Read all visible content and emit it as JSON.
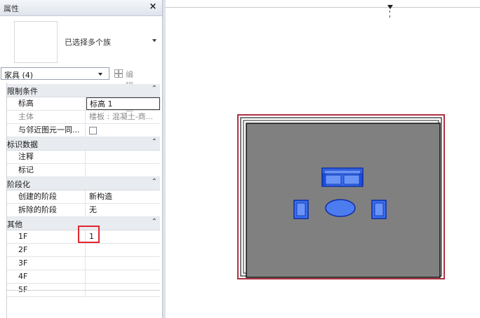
{
  "palette": {
    "title": "属性",
    "close_glyph": "×",
    "type_selector": {
      "label": "已选择多个族",
      "dropdown_icon": "chevron-down-icon"
    },
    "filter": {
      "label": "家具 (4)",
      "edit_type_label": "编辑类型"
    },
    "groups": [
      {
        "label": "限制条件",
        "collapse_glyph": "⌃",
        "rows": [
          {
            "name": "标高",
            "value": "标高 1",
            "editing": true,
            "dim": false
          },
          {
            "name": "主体",
            "value": "楼板 : 混凝土-商...",
            "editing": false,
            "dim": true
          },
          {
            "name": "与邻近图元一同...",
            "value": "",
            "checkbox": true
          }
        ]
      },
      {
        "label": "标识数据",
        "collapse_glyph": "⌃",
        "rows": [
          {
            "name": "注释",
            "value": ""
          },
          {
            "name": "标记",
            "value": ""
          }
        ]
      },
      {
        "label": "阶段化",
        "collapse_glyph": "⌃",
        "rows": [
          {
            "name": "创建的阶段",
            "value": "新构造"
          },
          {
            "name": "拆除的阶段",
            "value": "无"
          }
        ]
      },
      {
        "label": "其他",
        "collapse_glyph": "⌃",
        "rows": [
          {
            "name": "1F",
            "value": "1"
          },
          {
            "name": "2F",
            "value": ""
          },
          {
            "name": "3F",
            "value": ""
          },
          {
            "name": "4F",
            "value": ""
          },
          {
            "name": "5F",
            "value": ""
          }
        ]
      }
    ]
  },
  "colors": {
    "floor_fill": "#808080",
    "wall_outer": "#b03040",
    "selection_blue": "#1e50e6",
    "highlight_red": "#e0282e"
  }
}
